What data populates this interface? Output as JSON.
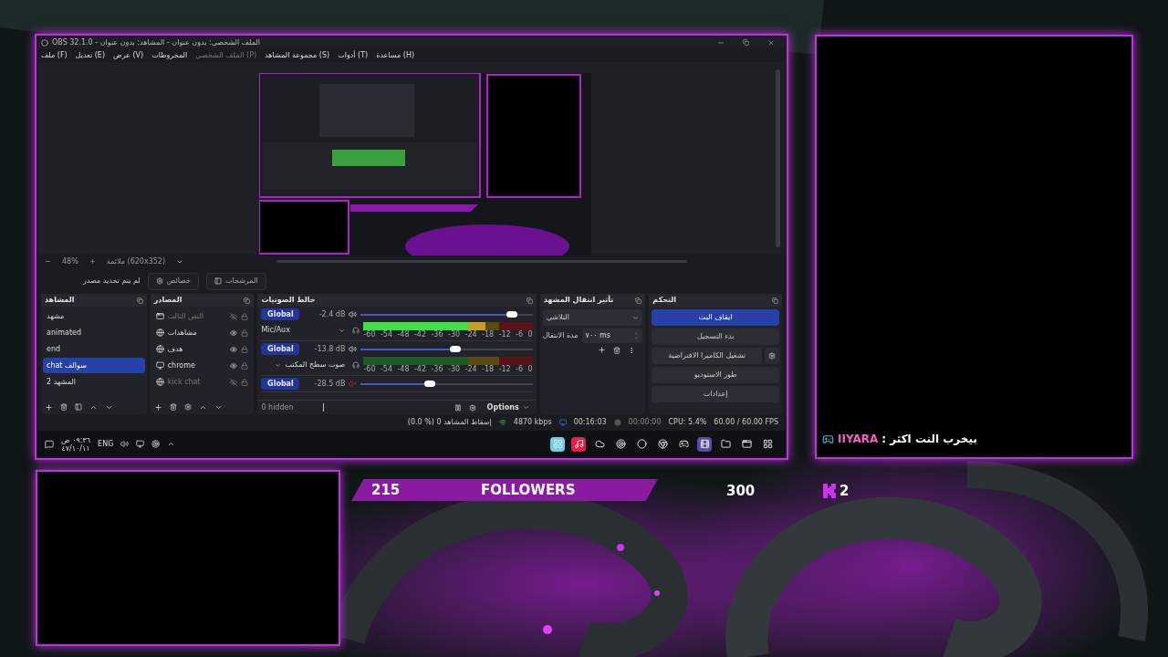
{
  "obs_window": {
    "title": "OBS 32.1.0 - الملف الشخصي: بدون عنوان - المشاهد: بدون عنوان",
    "menu": [
      {
        "label": "مساعدة (H)",
        "disabled": false
      },
      {
        "label": "أدوات (T)",
        "disabled": false
      },
      {
        "label": "مجموعة المشاهد (S)",
        "disabled": false
      },
      {
        "label": "الملف الشخصي (P)",
        "disabled": true
      },
      {
        "label": "المخروطات",
        "disabled": false
      },
      {
        "label": "عرض (V)",
        "disabled": false
      },
      {
        "label": "تعديل (E)",
        "disabled": false
      },
      {
        "label": "ملف (F)",
        "disabled": false
      }
    ],
    "preview_toolbar": {
      "zoom": "48%",
      "fit": "ملائمة (620x352)"
    },
    "source_bar": {
      "status": "لم يتم تحديد مصدر",
      "properties": "خصائص",
      "filters": "المرشحات"
    },
    "scenes": {
      "title": "المشاهد",
      "items": [
        {
          "label": "مشهد",
          "selected": false
        },
        {
          "label": "animated",
          "selected": false
        },
        {
          "label": "end",
          "selected": false
        },
        {
          "label": "chat سوالف",
          "selected": true
        },
        {
          "label": "المشهد 2",
          "selected": false
        }
      ]
    },
    "sources": {
      "title": "المصادر",
      "items": [
        {
          "name": "النص الثالث",
          "kind": "window",
          "visible": false
        },
        {
          "name": "مشاهدات",
          "kind": "browser",
          "visible": true
        },
        {
          "name": "هدف",
          "kind": "browser",
          "visible": true
        },
        {
          "name": "chrome",
          "kind": "display",
          "visible": true
        },
        {
          "name": "kick chat",
          "kind": "browser",
          "visible": false
        }
      ]
    },
    "mixer": {
      "title": "خالط الصوتيات",
      "channels": [
        {
          "button": "Global",
          "db": "-2.4 dB",
          "muted": false,
          "level": 0.88,
          "name": "Mic/Aux",
          "meter": {
            "level": 0.72
          },
          "scale": [
            "0",
            "-6",
            "-12",
            "-18",
            "-24",
            "-30",
            "-36",
            "-42",
            "-48",
            "-54",
            "-60"
          ]
        },
        {
          "button": "Global",
          "db": "-13.8 dB",
          "muted": false,
          "level": 0.55,
          "name": "صوت سطح المكتب",
          "scale": [
            "0",
            "-6",
            "-12",
            "-18",
            "-24",
            "-30",
            "-36",
            "-42",
            "-48",
            "-54",
            "-60"
          ]
        },
        {
          "button": "Global",
          "db": "-28.5 dB",
          "muted": true,
          "level": 0.4
        }
      ],
      "hidden": "0 hidden",
      "options": "Options"
    },
    "transitions": {
      "title": "تأثير انتقال المشهد",
      "selected": "التلاشي",
      "duration_label": "مدة الانتقال",
      "duration": "٧٠٠ ms"
    },
    "controls": {
      "title": "التحكم",
      "buttons": [
        {
          "label": "ايقاف البث",
          "active": true,
          "has_settings": false
        },
        {
          "label": "بدء التسجيل",
          "active": false,
          "has_settings": false
        },
        {
          "label": "تشغيل الكاميرا الافتراضية",
          "active": false,
          "has_settings": true
        },
        {
          "label": "طور الاستوديو",
          "active": false,
          "has_settings": false
        },
        {
          "label": "إعدادات",
          "active": false,
          "has_settings": false
        }
      ]
    },
    "status_bar": {
      "dropped": "(0.0 %) 0 إسقاط المشاهد",
      "bitrate": "4870 kbps",
      "stream_time": "00:16:03",
      "record_time": "00:00:00",
      "cpu": "CPU: 5.4%",
      "fps": "60.00 / 60.00 FPS"
    },
    "taskbar": {
      "time": "٠٩:٣٦ ص",
      "date": "٤٧/١٠/١١",
      "language": "ENG"
    }
  },
  "chat_frame": {
    "user": "IIYARA",
    "message": ": بيخرب النت اكثر"
  },
  "followers": {
    "current": "215",
    "label": "FOLLOWERS",
    "goal": "300"
  },
  "kick": {
    "count": "2"
  }
}
